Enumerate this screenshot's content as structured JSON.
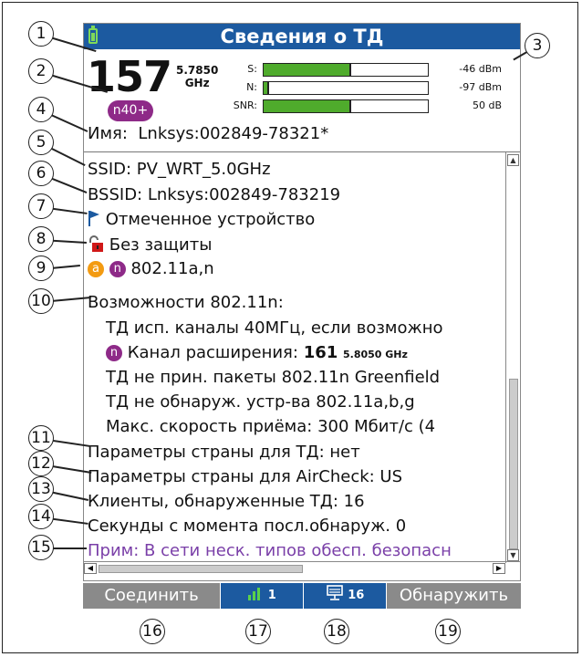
{
  "header": {
    "title": "Сведения о ТД"
  },
  "summary": {
    "channel": "157",
    "frequency_value": "5.7850",
    "frequency_unit": "GHz",
    "mode_badge": "n40+",
    "name_label": "Имя:",
    "name_value": "Lnksys:002849-78321*"
  },
  "signal": [
    {
      "label": "S:",
      "level": 0.52,
      "value": "-46 dBm"
    },
    {
      "label": "N:",
      "level": 0.02,
      "value": "-97 dBm"
    },
    {
      "label": "SNR:",
      "level": 0.52,
      "value": "50 dB"
    }
  ],
  "details": {
    "ssid": "SSID: PV_WRT_5.0GHz",
    "bssid": "BSSID: Lnksys:002849-783219",
    "flagged": "Отмеченное устройство",
    "security": "Без защиты",
    "proto_a": "a",
    "proto_n": "n",
    "standards": "802.11a,n",
    "caps_header": "Возможности 802.11n:",
    "cap1": "ТД исп. каналы 40МГц, если возможно",
    "ext_tag": "n",
    "ext_label": "Канал расширения:",
    "ext_channel": "161",
    "ext_freq": "5.8050 GHz",
    "cap3": "ТД не прин. пакеты 802.11n Greenfield",
    "cap4": "ТД не обнаруж. устр-ва 802.11a,b,g",
    "cap5": "Макс. скорость приёма: 300 Мбит/с (4",
    "country_ap": "Параметры страны для ТД: нет",
    "country_aircheck": "Параметры страны для AirCheck: US",
    "clients": "Клиенты, обнаруженные ТД: 16",
    "seconds": "Секунды с момента посл.обнаруж. 0",
    "note": "Прим: В сети неск. типов обесп. безопасн"
  },
  "softkeys": {
    "connect": "Соединить",
    "signal_count": "1",
    "clients_count": "16",
    "discover": "Обнаружить"
  },
  "callouts": [
    "1",
    "2",
    "3",
    "4",
    "5",
    "6",
    "7",
    "8",
    "9",
    "10",
    "11",
    "12",
    "13",
    "14",
    "15",
    "16",
    "17",
    "18",
    "19"
  ],
  "colors": {
    "titlebar": "#1c5aa0",
    "signal_fill": "#4fab2c",
    "badge": "#8e2a88",
    "note_text": "#7a3fa8",
    "softkey_gray": "#8a8a8a"
  }
}
